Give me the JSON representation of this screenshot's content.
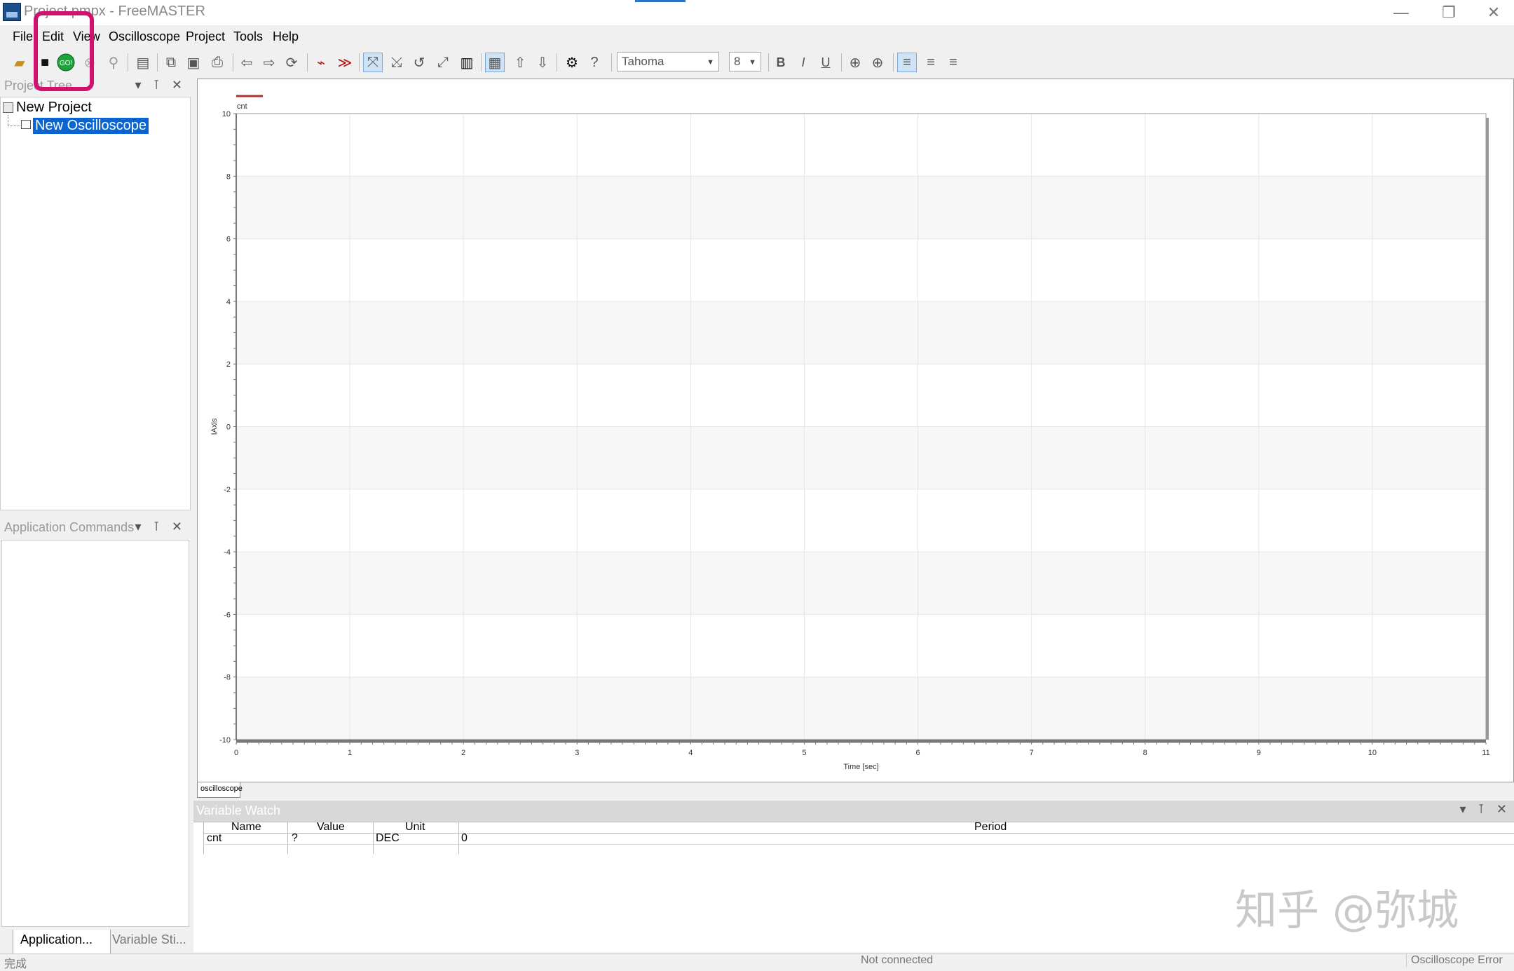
{
  "window": {
    "title": "Project.pmpx - FreeMASTER",
    "minimize_glyph": "—",
    "restore_glyph": "❐",
    "close_glyph": "✕"
  },
  "menu": [
    "File",
    "Edit",
    "View",
    "Oscilloscope",
    "Project",
    "Tools",
    "Help"
  ],
  "toolbar": {
    "font_name": "Tahoma",
    "font_size": "8",
    "icons": [
      "open-icon",
      "save-icon",
      "go-icon",
      "stop-icon",
      "connect-icon",
      "properties-icon",
      "copy-icon",
      "paste-icon",
      "print-icon",
      "back-icon",
      "forward-icon",
      "refresh-icon",
      "record-icon",
      "scope-icon",
      "zoom-icon",
      "zoom-out-icon",
      "undo-zoom-icon",
      "fit-icon",
      "clipboard-icon",
      "grid-icon",
      "up-icon",
      "down-icon",
      "settings-icon",
      "help-icon",
      "bold-icon",
      "italic-icon",
      "underline-icon",
      "align-left-icon",
      "align-center-icon",
      "align-right-icon"
    ]
  },
  "project_tree": {
    "title": "Project Tree",
    "root": "New Project",
    "child": "New Oscilloscope"
  },
  "app_commands": {
    "title": "Application Commands"
  },
  "bottom_tabs": [
    "Application...",
    "Variable Sti..."
  ],
  "document_tab": "oscilloscope",
  "chart_data": {
    "type": "line",
    "series": [
      {
        "name": "cnt",
        "color": "#b03030",
        "values": []
      }
    ],
    "xlabel": "Time [sec]",
    "ylabel": "IAxis",
    "xlim": [
      0,
      11
    ],
    "ylim": [
      -10,
      10
    ],
    "xticks": [
      "0",
      "1",
      "2",
      "3",
      "4",
      "5",
      "6",
      "7",
      "8",
      "9",
      "10",
      "11"
    ],
    "yticks": [
      "10",
      "8",
      "6",
      "4",
      "2",
      "0",
      "-2",
      "-4",
      "-6",
      "-8",
      "-10"
    ],
    "grid": true,
    "legend": "top-left"
  },
  "variable_watch": {
    "title": "Variable Watch",
    "columns": [
      "Name",
      "Value",
      "Unit",
      "Period"
    ],
    "rows": [
      {
        "name": "cnt",
        "value": "?",
        "unit": "DEC",
        "period": "0"
      }
    ]
  },
  "watermark": "知乎 @弥城",
  "status": {
    "left": "完成",
    "center": "Not connected",
    "right": "Oscilloscope Error"
  }
}
